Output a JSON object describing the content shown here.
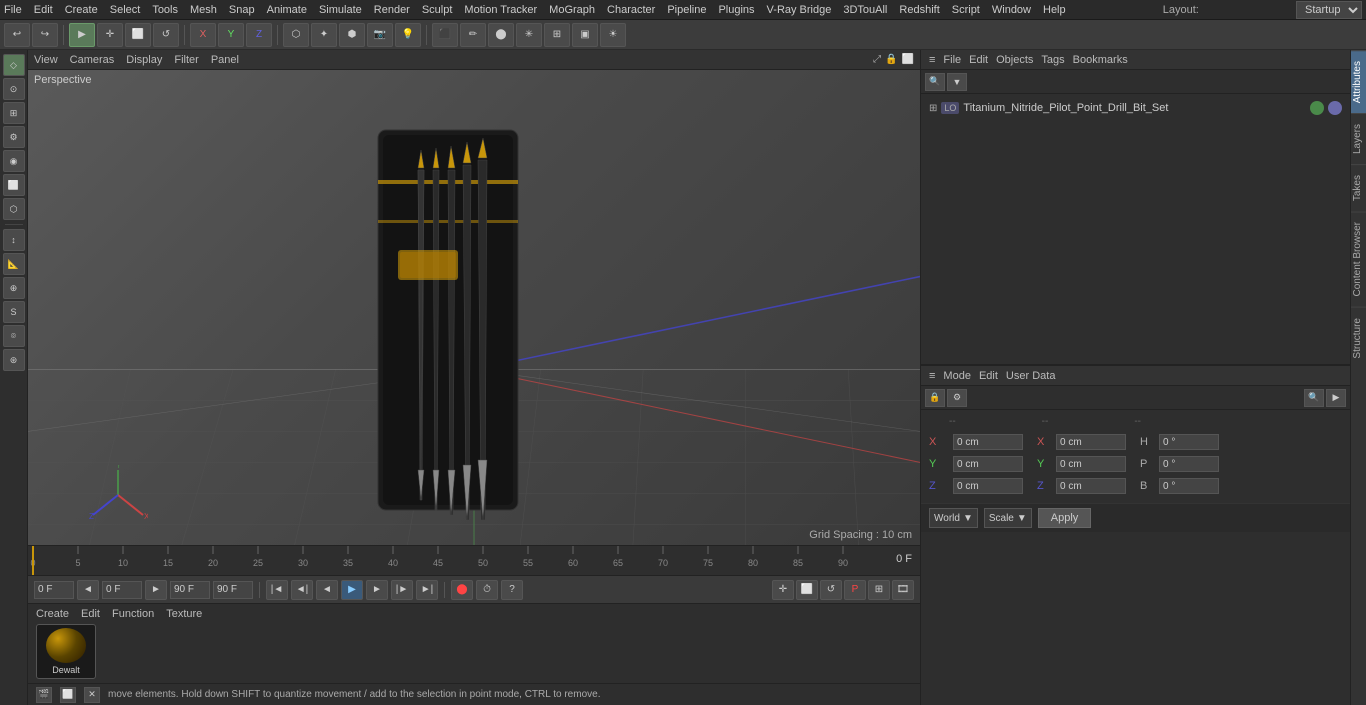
{
  "menu": {
    "items": [
      "File",
      "Edit",
      "Create",
      "Select",
      "Tools",
      "Mesh",
      "Snap",
      "Animate",
      "Simulate",
      "Render",
      "Sculpt",
      "Motion Tracker",
      "MoGraph",
      "Character",
      "Pipeline",
      "Plugins",
      "V-Ray Bridge",
      "3DTouAll",
      "Redshift",
      "Script",
      "Window",
      "Help"
    ]
  },
  "layout": {
    "label": "Layout:",
    "value": "Startup"
  },
  "toolbar": {
    "undo_label": "↩",
    "redo_label": "↪",
    "select_label": "▶",
    "move_label": "+",
    "scale_label": "⬛",
    "rotate_label": "↻",
    "x_label": "X",
    "y_label": "Y",
    "z_label": "Z"
  },
  "viewport": {
    "perspective_label": "Perspective",
    "menus": [
      "View",
      "Cameras",
      "Display",
      "Filter",
      "Panel"
    ],
    "grid_spacing": "Grid Spacing : 10 cm"
  },
  "timeline": {
    "ticks": [
      0,
      5,
      10,
      15,
      20,
      25,
      30,
      35,
      40,
      45,
      50,
      55,
      60,
      65,
      70,
      75,
      80,
      85,
      90
    ],
    "frame_label": "0 F"
  },
  "transport": {
    "start_frame": "0 F",
    "current_frame": "0 F",
    "end_frame": "90 F",
    "end_frame2": "90 F"
  },
  "material": {
    "menus": [
      "Create",
      "Edit",
      "Function",
      "Texture"
    ],
    "item_name": "Dewalt"
  },
  "status": {
    "text": "move elements. Hold down SHIFT to quantize movement / add to the selection in point mode, CTRL to remove.",
    "icon1": "🎬",
    "icon2": "⬜",
    "icon3": "✕"
  },
  "object_manager": {
    "header_icon": "≡",
    "menus": [
      "File",
      "Edit",
      "Objects",
      "Tags",
      "Bookmarks"
    ],
    "object_name": "Titanium_Nitride_Pilot_Point_Drill_Bit_Set"
  },
  "attributes": {
    "menus": [
      "Mode",
      "Edit",
      "User Data"
    ],
    "coords": {
      "x_label": "X",
      "x_val": "0 cm",
      "y_label": "Y",
      "y_val": "0 cm",
      "z_label": "Z",
      "z_val": "0 cm",
      "x2_label": "X",
      "x2_val": "0 cm",
      "y2_label": "Y",
      "y2_val": "0 cm",
      "z2_label": "Z",
      "z2_val": "0 cm",
      "h_label": "H",
      "h_val": "0 °",
      "p_label": "P",
      "p_val": "0 °",
      "b_label": "B",
      "b_val": "0 °"
    },
    "world_label": "World",
    "scale_label": "Scale",
    "apply_label": "Apply"
  },
  "right_tabs": [
    "Takes",
    "Content Browser",
    "Structure"
  ],
  "far_right_tabs": [
    "Attributes",
    "Layers"
  ]
}
